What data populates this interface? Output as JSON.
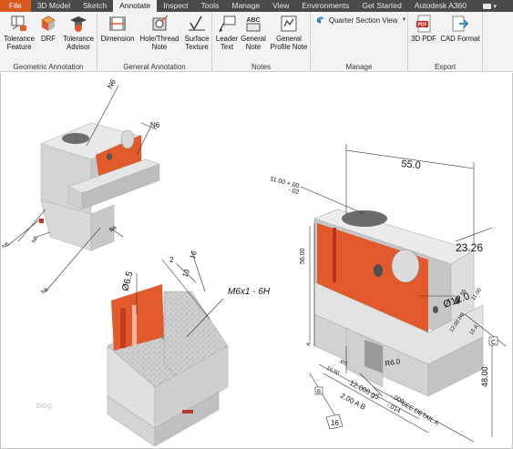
{
  "tabs": [
    {
      "label": "File"
    },
    {
      "label": "3D Model"
    },
    {
      "label": "Sketch"
    },
    {
      "label": "Annotate"
    },
    {
      "label": "Inspect"
    },
    {
      "label": "Tools"
    },
    {
      "label": "Manage"
    },
    {
      "label": "View"
    },
    {
      "label": "Environments"
    },
    {
      "label": "Get Started"
    },
    {
      "label": "Autodesk A360"
    }
  ],
  "active_tab": "Annotate",
  "ribbon": {
    "geometric": {
      "title": "Geometric Annotation",
      "tools": [
        {
          "label": "Tolerance\nFeature",
          "icon": "tolerance-feature-icon"
        },
        {
          "label": "DRF",
          "icon": "drf-icon"
        },
        {
          "label": "Tolerance\nAdvisor",
          "icon": "tolerance-advisor-icon"
        }
      ]
    },
    "general": {
      "title": "General Annotation",
      "tools": [
        {
          "label": "Dimension",
          "icon": "dimension-icon"
        },
        {
          "label": "Hole/Thread\nNote",
          "icon": "hole-thread-note-icon"
        },
        {
          "label": "Surface\nTexture",
          "icon": "surface-texture-icon"
        }
      ]
    },
    "notes": {
      "title": "Notes",
      "tools": [
        {
          "label": "Leader\nText",
          "icon": "leader-text-icon"
        },
        {
          "label": "General\nNote",
          "icon": "general-note-icon"
        },
        {
          "label": "General\nProfile Note",
          "icon": "general-profile-note-icon"
        }
      ]
    },
    "manage": {
      "title": "Manage",
      "dropdown": "Quarter Section View"
    },
    "export": {
      "title": "Export",
      "tools": [
        {
          "label": "3D PDF",
          "icon": "pdf-icon"
        },
        {
          "label": "CAD Format",
          "icon": "cad-format-icon"
        }
      ]
    }
  },
  "colors": {
    "tab_bar": "#4a4a4a",
    "file_tab": "#d65a1e",
    "ribbon": "#f3f3f3",
    "part_gray": "#d9d9d9",
    "feature_orange": "#e2592c"
  },
  "canvas": {
    "watermark": "blog",
    "left_model": {
      "labels": [
        "N6",
        "N6",
        "N6",
        "N6",
        "N6",
        "N6"
      ]
    },
    "section_model": {
      "labels": [
        "Ø6.5",
        "2",
        "16",
        "13",
        "M6x1 - 6H"
      ]
    },
    "right_model": {
      "labels": [
        "55.0",
        "23.26",
        "Ø12.0",
        "11.00 +.00",
        "-.02",
        "56.00",
        "R6.0",
        "12.000 g5",
        "-.006",
        "-.014",
        "2.00 A B",
        "SEE DETAIL A",
        "48.00",
        "12.00 H8",
        "15 A",
        "A",
        "B",
        "C",
        "16",
        "50",
        "11.00",
        "Ø5",
        "16.50"
      ]
    }
  }
}
